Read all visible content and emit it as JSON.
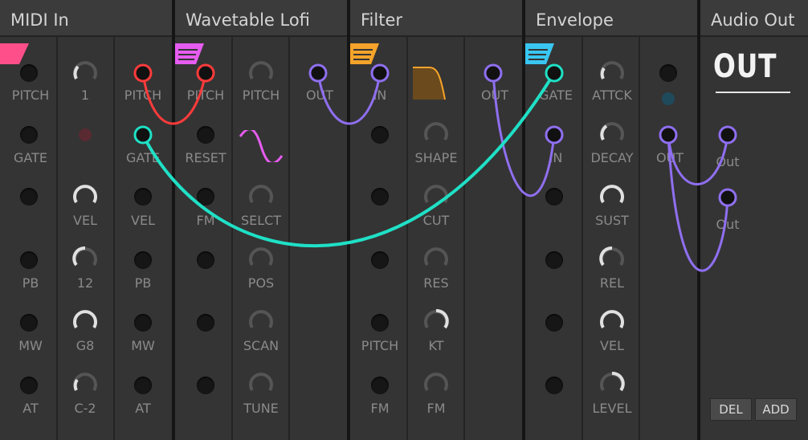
{
  "modules": [
    {
      "title": "MIDI In"
    },
    {
      "title": "Wavetable Lofi"
    },
    {
      "title": "Filter"
    },
    {
      "title": "Envelope"
    },
    {
      "title": "Audio Out"
    }
  ],
  "midi_in": {
    "col1": [
      "PITCH",
      "GATE",
      "",
      "PB",
      "MW",
      "AT"
    ],
    "col2": [
      "1",
      "",
      "VEL",
      "12",
      "G8",
      "C-2"
    ],
    "col3": [
      "PITCH",
      "GATE",
      "VEL",
      "PB",
      "MW",
      "AT"
    ]
  },
  "wavetable": {
    "col1": [
      "PITCH",
      "RESET",
      "FM",
      "",
      "",
      ""
    ],
    "col2": [
      "PITCH",
      "",
      "SELCT",
      "POS",
      "SCAN",
      "TUNE"
    ],
    "col3": [
      "OUT"
    ]
  },
  "filter": {
    "col1": [
      "IN",
      "",
      "",
      "",
      "PITCH",
      "FM"
    ],
    "col2": [
      "",
      "SHAPE",
      "CUT",
      "RES",
      "KT",
      "FM"
    ],
    "col3": [
      "OUT"
    ]
  },
  "envelope": {
    "col1": [
      "GATE",
      "IN",
      "",
      "",
      "",
      ""
    ],
    "col2": [
      "ATTCK",
      "DECAY",
      "SUST",
      "REL",
      "VEL",
      "LEVEL"
    ],
    "col3": [
      "",
      "OUT"
    ]
  },
  "audio_out": {
    "big_label": "OUT",
    "ports": [
      "Out",
      "Out"
    ],
    "del_label": "DEL",
    "add_label": "ADD"
  },
  "colors": {
    "midi_accent": "#ff4f8b",
    "wavetable_accent": "#e65cf0",
    "filter_accent": "#f5a32a",
    "envelope_accent": "#39c6f0",
    "cable_red": "#ff3b3b",
    "cable_purple": "#8f6ff0",
    "cable_teal": "#1fe0c6"
  }
}
